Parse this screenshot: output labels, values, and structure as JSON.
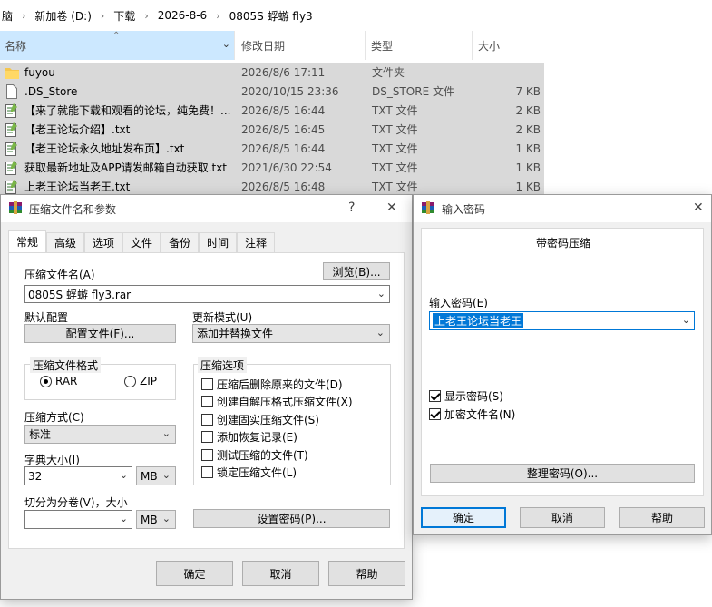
{
  "explorer": {
    "breadcrumb": [
      "脑",
      "新加卷 (D:)",
      "下载",
      "2026-8-6",
      "0805S 蜉蝣 fly3"
    ],
    "columns": {
      "name": "名称",
      "date": "修改日期",
      "type": "类型",
      "size": "大小"
    },
    "files": [
      {
        "icon": "folder-icon",
        "name": "fuyou",
        "date": "2026/8/6 17:11",
        "type": "文件夹",
        "size": ""
      },
      {
        "icon": "file-icon",
        "name": ".DS_Store",
        "date": "2020/10/15 23:36",
        "type": "DS_STORE 文件",
        "size": "7 KB"
      },
      {
        "icon": "text-file-icon",
        "name": "【来了就能下载和观看的论坛，纯免费！...",
        "date": "2026/8/5 16:44",
        "type": "TXT 文件",
        "size": "2 KB"
      },
      {
        "icon": "text-file-icon",
        "name": "【老王论坛介绍】.txt",
        "date": "2026/8/5 16:45",
        "type": "TXT 文件",
        "size": "2 KB"
      },
      {
        "icon": "text-file-icon",
        "name": "【老王论坛永久地址发布页】.txt",
        "date": "2026/8/5 16:44",
        "type": "TXT 文件",
        "size": "1 KB"
      },
      {
        "icon": "text-file-icon",
        "name": "获取最新地址及APP请发邮箱自动获取.txt",
        "date": "2021/6/30 22:54",
        "type": "TXT 文件",
        "size": "1 KB"
      },
      {
        "icon": "text-file-icon",
        "name": "上老王论坛当老王.txt",
        "date": "2026/8/5 16:48",
        "type": "TXT 文件",
        "size": "1 KB"
      }
    ]
  },
  "archive_dialog": {
    "title": "压缩文件名和参数",
    "help": "?",
    "close": "✕",
    "tabs": [
      "常规",
      "高级",
      "选项",
      "文件",
      "备份",
      "时间",
      "注释"
    ],
    "archive_name_label": "压缩文件名(A)",
    "browse_button": "浏览(B)...",
    "archive_name_value": "0805S 蜉蝣 fly3.rar",
    "default_profile_label": "默认配置",
    "profiles_button": "配置文件(F)...",
    "update_mode_label": "更新模式(U)",
    "update_mode_value": "添加并替换文件",
    "format_group": "压缩文件格式",
    "format_rar": "RAR",
    "format_zip": "ZIP",
    "method_label": "压缩方式(C)",
    "method_value": "标准",
    "dict_label": "字典大小(I)",
    "dict_value": "32",
    "dict_unit": "MB",
    "split_label": "切分为分卷(V)，大小",
    "split_value": "",
    "split_unit": "MB",
    "options_group": "压缩选项",
    "options": [
      {
        "label": "压缩后删除原来的文件(D)",
        "checked": false
      },
      {
        "label": "创建自解压格式压缩文件(X)",
        "checked": false
      },
      {
        "label": "创建固实压缩文件(S)",
        "checked": false
      },
      {
        "label": "添加恢复记录(E)",
        "checked": false
      },
      {
        "label": "测试压缩的文件(T)",
        "checked": false
      },
      {
        "label": "锁定压缩文件(L)",
        "checked": false
      }
    ],
    "set_password_button": "设置密码(P)...",
    "ok": "确定",
    "cancel": "取消",
    "help_button": "帮助"
  },
  "password_dialog": {
    "title": "输入密码",
    "close": "✕",
    "heading": "带密码压缩",
    "password_label": "输入密码(E)",
    "password_value": "上老王论坛当老王",
    "show_password": "显示密码(S)",
    "encrypt_names": "加密文件名(N)",
    "organize_button": "整理密码(O)...",
    "ok": "确定",
    "cancel": "取消",
    "help_button": "帮助"
  }
}
